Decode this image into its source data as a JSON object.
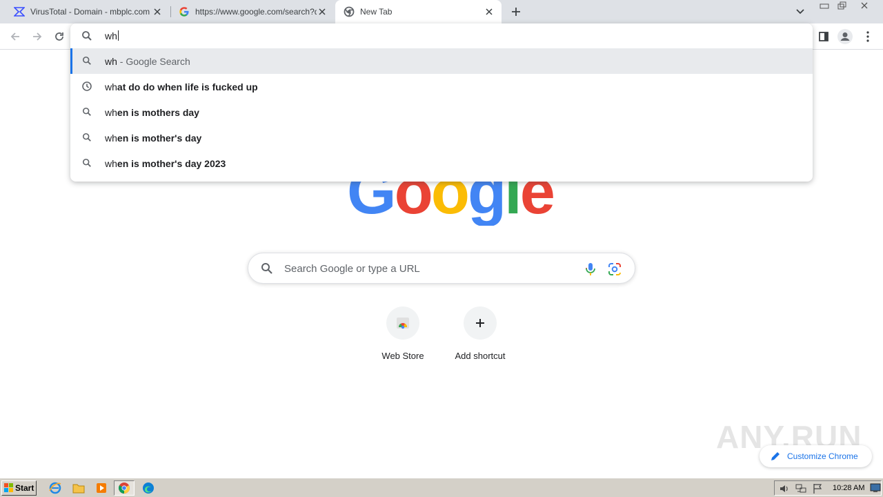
{
  "tabs": [
    {
      "title": "VirusTotal - Domain - mbplc.com",
      "favicon": "virustotal-icon",
      "active": false
    },
    {
      "title": "https://www.google.com/search?q=",
      "favicon": "google-g-icon",
      "active": false
    },
    {
      "title": "New Tab",
      "favicon": "chrome-icon",
      "active": true
    }
  ],
  "omnibox": {
    "typed": "wh",
    "suggestions": [
      {
        "typed": "wh",
        "rest": "",
        "desc": " - Google Search",
        "icon": "search-icon",
        "selected": true
      },
      {
        "typed": "wh",
        "rest": "at do do when life is fucked up",
        "desc": "",
        "icon": "history-icon",
        "selected": false
      },
      {
        "typed": "wh",
        "rest": "en is mothers day",
        "desc": "",
        "icon": "search-icon",
        "selected": false
      },
      {
        "typed": "wh",
        "rest": "en is mother's day",
        "desc": "",
        "icon": "search-icon",
        "selected": false
      },
      {
        "typed": "wh",
        "rest": "en is mother's day 2023",
        "desc": "",
        "icon": "search-icon",
        "selected": false
      }
    ]
  },
  "page": {
    "logo": "Google",
    "search_placeholder": "Search Google or type a URL",
    "shortcuts": [
      {
        "label": "Web Store",
        "icon": "web-store-icon"
      },
      {
        "label": "Add shortcut",
        "icon": "plus-icon"
      }
    ],
    "customize_label": "Customize Chrome",
    "watermark": "ANY.RUN"
  },
  "taskbar": {
    "start_label": "Start",
    "clock": "10:28 AM"
  },
  "colors": {
    "accent": "#1a73e8",
    "tabstrip": "#dee1e6",
    "taskbar": "#d4d0c8"
  }
}
